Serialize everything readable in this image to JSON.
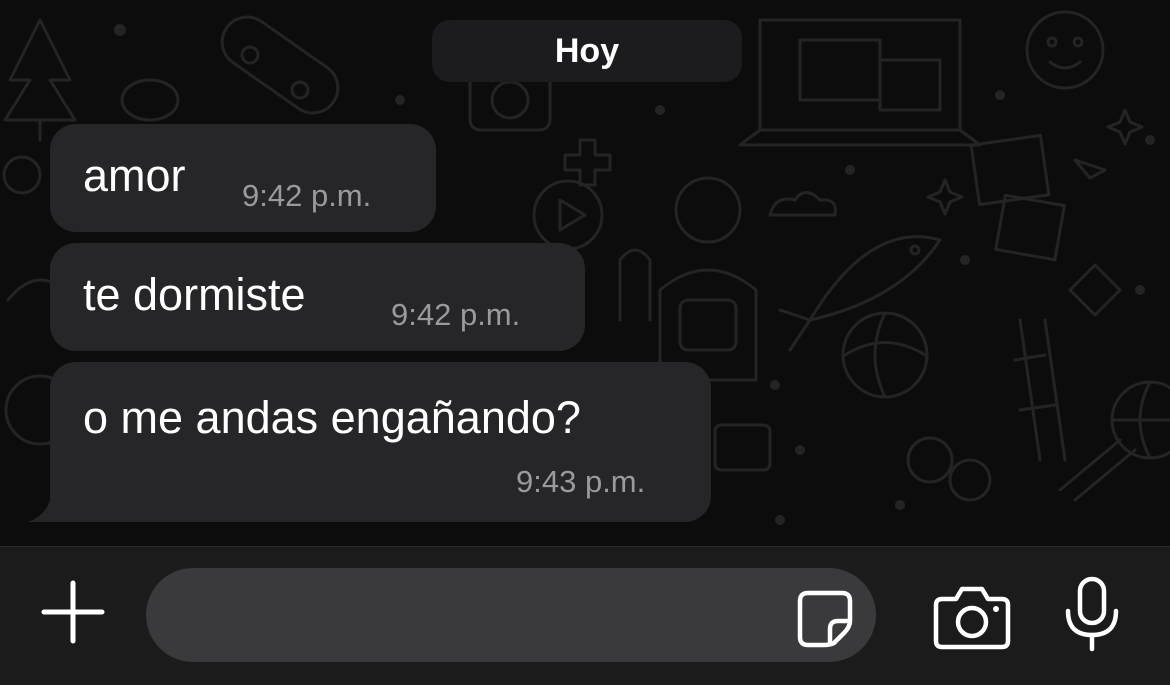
{
  "chat": {
    "date_label": "Hoy",
    "messages": [
      {
        "text": "amor",
        "time": "9:42 p.m."
      },
      {
        "text": "te dormiste",
        "time": "9:42 p.m."
      },
      {
        "text": "o me andas engañando?",
        "time": "9:43 p.m."
      }
    ]
  },
  "composer": {
    "input_value": "",
    "icons": [
      "plus-icon",
      "sticker-icon",
      "camera-icon",
      "microphone-icon"
    ]
  },
  "colors": {
    "background": "#0c0c0c",
    "bubble": "#262628",
    "input_bar": "#1b1b1b",
    "input_field": "#3a3a3c",
    "text": "#ffffff",
    "timestamp": "#9a9a9e"
  }
}
